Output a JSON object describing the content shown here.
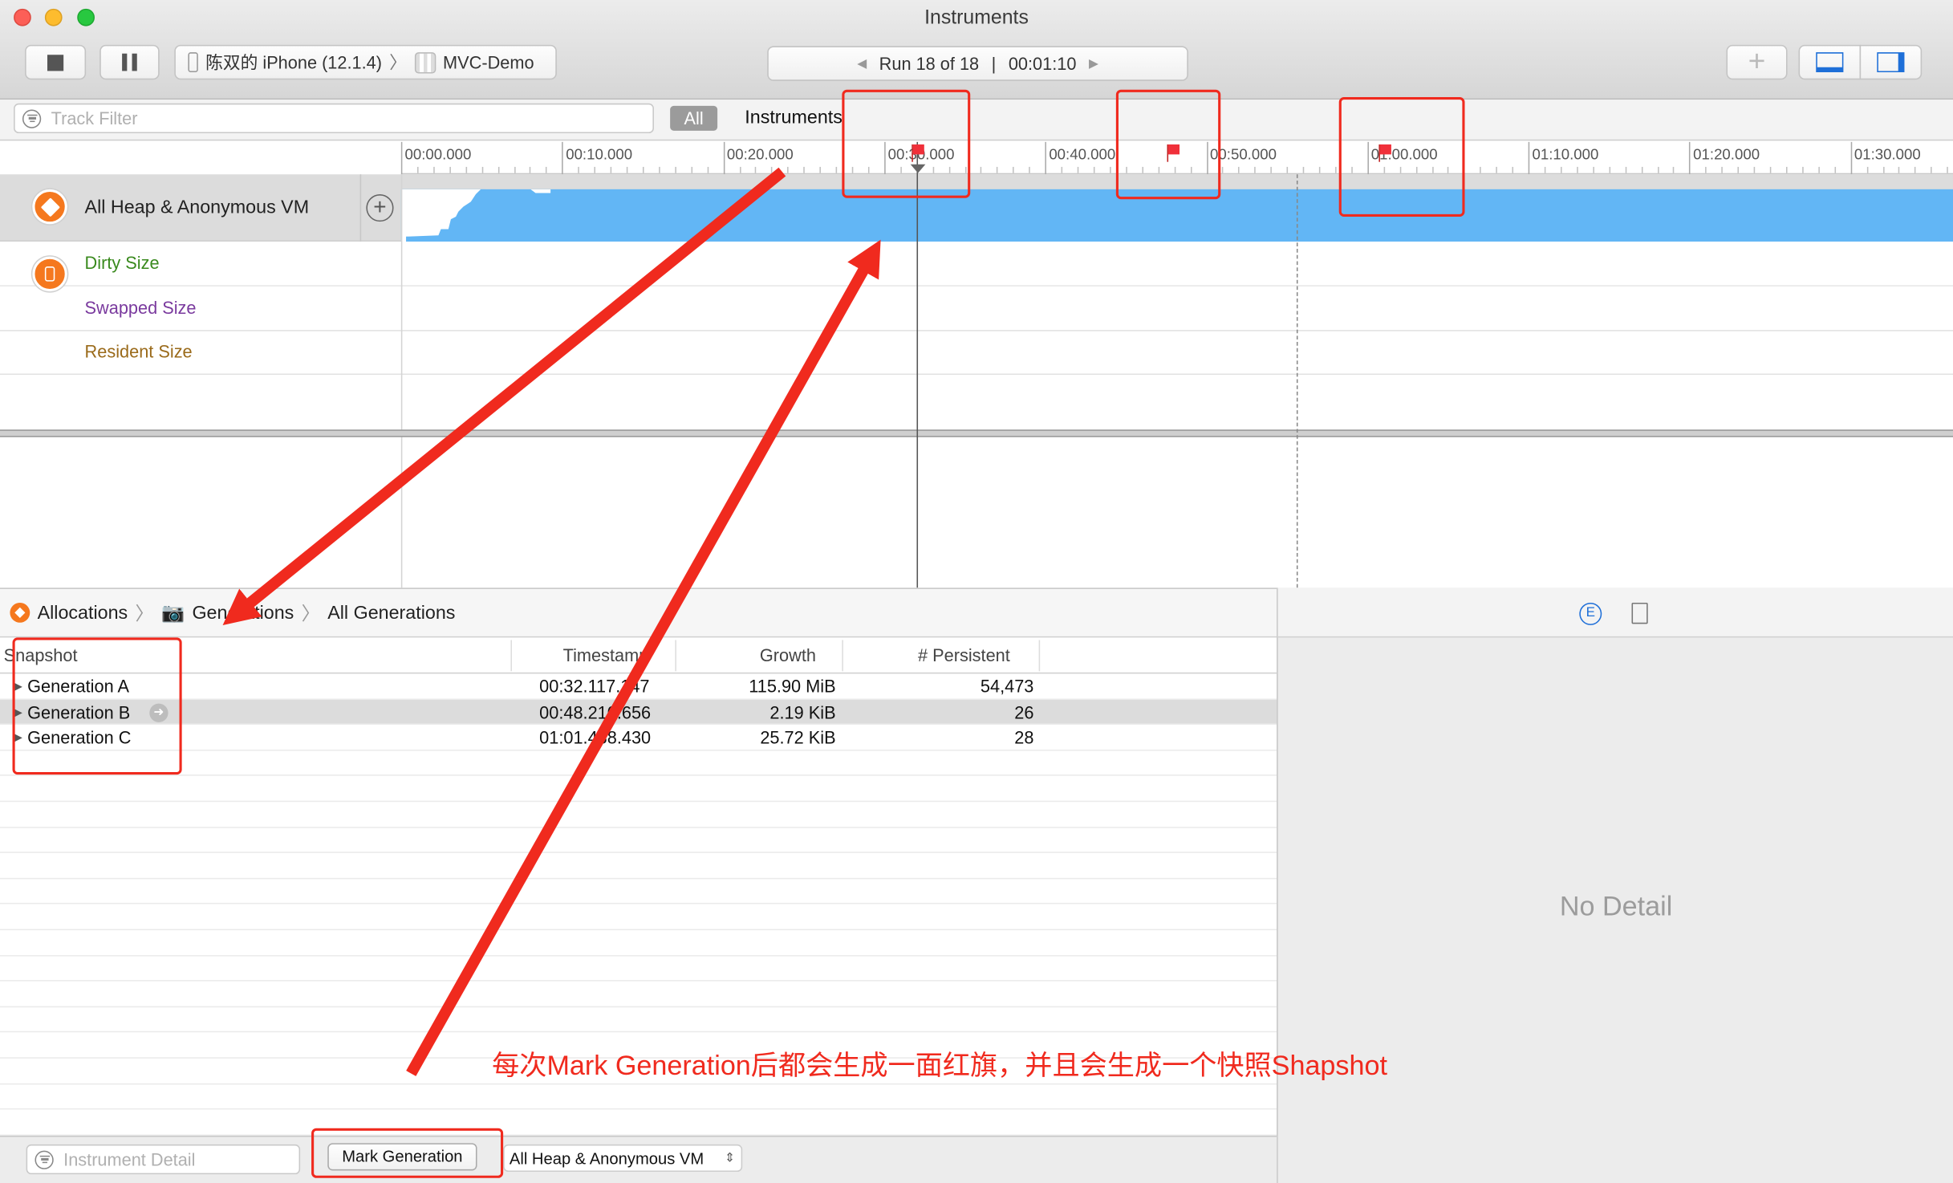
{
  "window": {
    "title": "Instruments"
  },
  "toolbar": {
    "device": "陈双的 iPhone (12.1.4)",
    "separator": "〉",
    "app": "MVC-Demo",
    "run_label": "Run 18 of 18",
    "run_divider": "|",
    "run_time": "00:01:10",
    "add_symbol": "+"
  },
  "filter": {
    "track_filter_placeholder": "Track Filter",
    "all_label": "All",
    "instruments_label": "Instruments"
  },
  "ruler": {
    "ticks": [
      "00:00.000",
      "00:10.000",
      "00:20.000",
      "00:30.000",
      "00:40.000",
      "00:50.000",
      "01:00.000",
      "01:10.000",
      "01:20.000",
      "01:30.000"
    ]
  },
  "tracks": {
    "main": "All Heap & Anonymous VM",
    "dirty": "Dirty Size",
    "swapped": "Swapped Size",
    "resident": "Resident Size",
    "colors": {
      "dirty": "#3a8a1e",
      "swapped": "#7a3a9e",
      "resident": "#9a6a1a",
      "band": "#62b6f5"
    }
  },
  "breadcrumb": {
    "allocations": "Allocations",
    "generations": "Generations",
    "all_generations": "All Generations",
    "sep": "〉"
  },
  "table": {
    "headers": {
      "snapshot": "Snapshot",
      "timestamp": "Timestamp",
      "growth": "Growth",
      "persistent": "# Persistent"
    },
    "rows": [
      {
        "name": "Generation A",
        "timestamp": "00:32.117.147",
        "growth": "115.90 MiB",
        "persistent": "54,473"
      },
      {
        "name": "Generation B",
        "timestamp": "00:48.210.656",
        "growth": "2.19 KiB",
        "persistent": "26"
      },
      {
        "name": "Generation C",
        "timestamp": "01:01.488.430",
        "growth": "25.72 KiB",
        "persistent": "28"
      }
    ]
  },
  "right_pane": {
    "no_detail": "No Detail",
    "inspector_letter": "E"
  },
  "bottom": {
    "instrument_detail_placeholder": "Instrument Detail",
    "mark_generation": "Mark Generation",
    "heap_select": "All Heap & Anonymous VM"
  },
  "annotation": {
    "caption": "每次Mark Generation后都会生成一面红旗，并且会生成一个快照Shapshot",
    "color": "#f02a1e"
  }
}
